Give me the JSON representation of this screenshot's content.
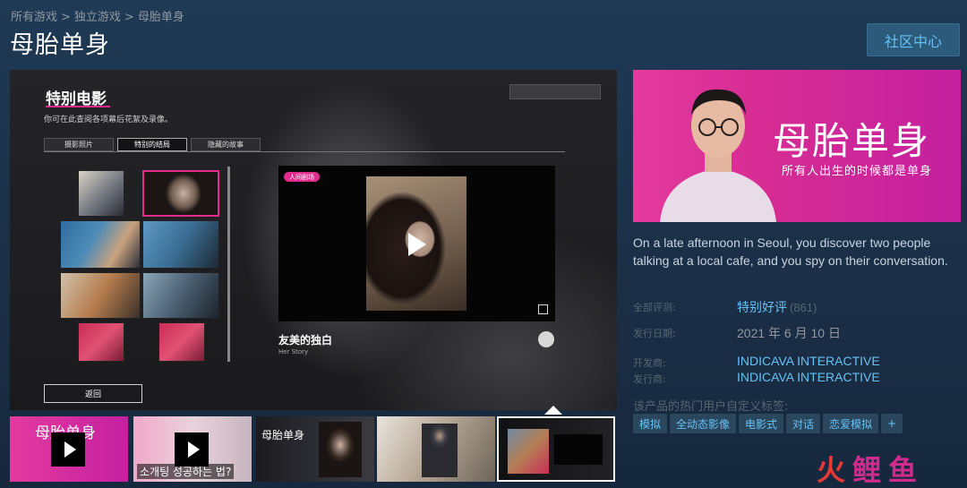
{
  "breadcrumb": [
    "所有游戏",
    "独立游戏",
    "母胎单身"
  ],
  "breadcrumb_sep": ">",
  "title": "母胎单身",
  "community_button": "社区中心",
  "viewer": {
    "heading": "特别电影",
    "subtitle": "你可在此查阅各项幕后花絮及录像。",
    "tabs": [
      "摄影照片",
      "特别的结局",
      "隐藏的故事"
    ],
    "active_tab": 1,
    "player_tag": "人间剧场",
    "caption_title": "友美的独白",
    "caption_sub": "Her Story",
    "back_button": "返回"
  },
  "strip": {
    "thumb1_text": "母胎单身",
    "thumb2_text": "소개팅 성공하는 법?",
    "thumb3_text": "母胎单身"
  },
  "capsule": {
    "title": "母胎单身",
    "subtitle": "所有人出生的时候都是单身"
  },
  "description": "On a late afternoon in Seoul, you discover two people talking at a local cafe, and you spy on their conversation.",
  "info": {
    "reviews_label": "全部评测:",
    "reviews_value": "特别好评",
    "reviews_count": "(861)",
    "release_label": "发行日期:",
    "release_value": "2021 年 6 月 10 日",
    "developer_label": "开发商:",
    "developer_value": "INDICAVA INTERACTIVE",
    "publisher_label": "发行商:",
    "publisher_value": "INDICAVA INTERACTIVE"
  },
  "tags_label": "该产品的热门用户自定义标签:",
  "tags": [
    "模拟",
    "全动态影像",
    "电影式",
    "对话",
    "恋爱模拟",
    "+"
  ],
  "watermark": {
    "part1": "火",
    "part2": "鲤鱼"
  },
  "colors": {
    "accent": "#67c1f5",
    "pink": "#e32b8e",
    "background": "#1b2f47"
  }
}
